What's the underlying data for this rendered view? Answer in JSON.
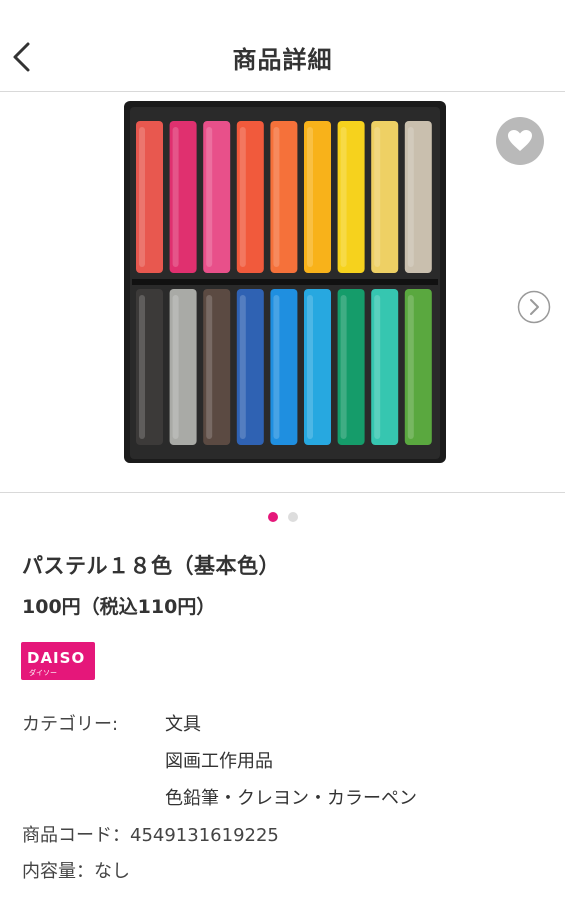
{
  "header": {
    "title": "商品詳細",
    "back_icon": "chevron-left-icon"
  },
  "gallery": {
    "image_alt": "パステル１８色（基本色）",
    "favorite_icon": "heart-icon",
    "next_icon": "chevron-right-circle-icon",
    "page_count": 2,
    "current_page": 1,
    "accent_color": "#e5177a",
    "pastel_colors_top": [
      "#e8584f",
      "#e0306f",
      "#e8508a",
      "#f15a3c",
      "#f5713a",
      "#f8b21a",
      "#f6d21d",
      "#eed064",
      "#c9bfae"
    ],
    "pastel_colors_bottom": [
      "#3c3a39",
      "#a9aaa6",
      "#5b4a42",
      "#2f62b3",
      "#1f8fe0",
      "#27a8e0",
      "#159c6a",
      "#36c6b0",
      "#5aa83f"
    ]
  },
  "product": {
    "name": "パステル１８色（基本色）",
    "price": "100円（税込110円）"
  },
  "brand": {
    "main": "DAISO",
    "sub": "ダイソー",
    "color": "#e5177a"
  },
  "specs": {
    "category_label": "カテゴリー:",
    "categories": [
      "文具",
      "図画工作用品",
      "色鉛筆・クレヨン・カラーペン"
    ],
    "code_label": "商品コード：",
    "code_value": "4549131619225",
    "content_label": "内容量：",
    "content_value": "なし"
  }
}
